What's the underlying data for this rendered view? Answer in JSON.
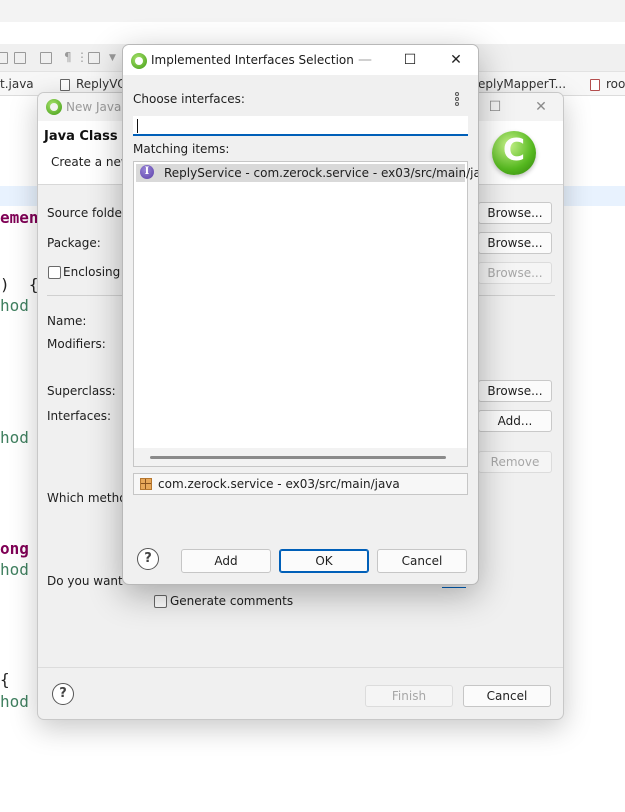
{
  "ide": {
    "tabs": [
      {
        "label": "t.java"
      },
      {
        "label": "ReplyVO"
      },
      {
        "label": "eplyMapperT..."
      },
      {
        "label": "roo"
      }
    ],
    "code_lines": [
      {
        "text": "emen",
        "kind": "kw"
      },
      {
        "text": ")  {",
        "kind": "pl"
      },
      {
        "text": "hod",
        "kind": "cm"
      },
      {
        "text": "hod",
        "kind": "cm"
      },
      {
        "text": "ong",
        "kind": "kw"
      },
      {
        "text": "hod",
        "kind": "cm"
      },
      {
        "text": "{",
        "kind": "pl"
      },
      {
        "text": "hod",
        "kind": "cm"
      }
    ]
  },
  "new_class_dialog": {
    "title": "New Java C",
    "heading": "Java Class",
    "subtitle": "Create a new",
    "labels": {
      "source_folder": "Source folder:",
      "package": "Package:",
      "enclosing": "Enclosing t",
      "name": "Name:",
      "modifiers": "Modifiers:",
      "superclass": "Superclass:",
      "interfaces": "Interfaces:",
      "which_methods": "Which metho",
      "do_you_want": "Do you want t",
      "generate_comments": "Generate comments"
    },
    "buttons": {
      "browse_source": "Browse...",
      "browse_package": "Browse...",
      "browse_enclosing": "Browse...",
      "browse_superclass": "Browse...",
      "add_interface": "Add...",
      "remove_interface": "Remove",
      "finish": "Finish",
      "cancel": "Cancel"
    },
    "help_label": "?"
  },
  "interfaces_dialog": {
    "title": "Implemented Interfaces Selection",
    "choose_label": "Choose interfaces:",
    "filter_value": "",
    "matching_label": "Matching items:",
    "items": [
      {
        "icon": "I",
        "label": "ReplyService - com.zerock.service - ex03/src/main/java",
        "selected": true
      }
    ],
    "qualifier": "com.zerock.service - ex03/src/main/java",
    "buttons": {
      "help": "?",
      "add": "Add",
      "ok": "OK",
      "cancel": "Cancel"
    },
    "window_controls": {
      "minimize": "—",
      "maximize": "☐",
      "close": "✕"
    }
  }
}
